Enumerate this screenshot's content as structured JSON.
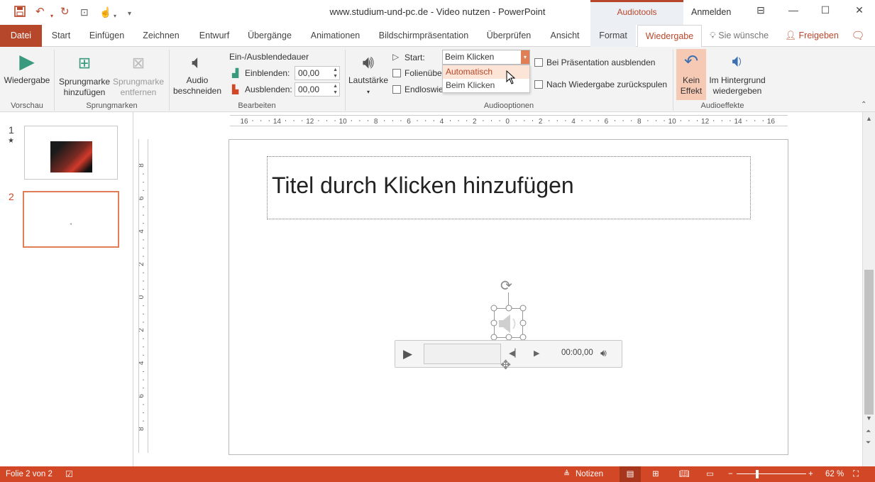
{
  "titlebar": {
    "title": "www.studium-und-pc.de - Video nutzen  -  PowerPoint",
    "context_group": "Audiotools",
    "signin": "Anmelden"
  },
  "tabs": {
    "file": "Datei",
    "items": [
      "Start",
      "Einfügen",
      "Zeichnen",
      "Entwurf",
      "Übergänge",
      "Animationen",
      "Bildschirmpräsentation",
      "Überprüfen",
      "Ansicht",
      "Format",
      "Wiedergabe"
    ],
    "tell_me": "Sie wünsche",
    "share": "Freigeben"
  },
  "ribbon": {
    "preview": {
      "play": "Wiedergabe",
      "group": "Vorschau"
    },
    "bookmarks": {
      "add_l1": "Sprungmarke",
      "add_l2": "hinzufügen",
      "remove_l1": "Sprungmarke",
      "remove_l2": "entfernen",
      "group": "Sprungmarken"
    },
    "editing": {
      "trim_l1": "Audio",
      "trim_l2": "beschneiden",
      "fade_title": "Ein-/Ausblendedauer",
      "fade_in_label": "Einblenden:",
      "fade_in_value": "00,00",
      "fade_out_label": "Ausblenden:",
      "fade_out_value": "00,00",
      "group": "Bearbeiten"
    },
    "audio_options": {
      "volume": "Lautstärke",
      "start_label": "Start:",
      "start_value": "Beim Klicken",
      "start_options": [
        "Automatisch",
        "Beim Klicken"
      ],
      "across_slides": "Folienübe",
      "loop": "Endloswie",
      "hide": "Bei Präsentation ausblenden",
      "rewind": "Nach Wiedergabe zurückspulen",
      "group": "Audiooptionen"
    },
    "audio_styles": {
      "none_l1": "Kein",
      "none_l2": "Effekt",
      "bg_l1": "Im Hintergrund",
      "bg_l2": "wiedergeben",
      "group": "Audioeffekte"
    }
  },
  "thumbnails": {
    "n1": "1",
    "star": "★",
    "n2": "2"
  },
  "slide": {
    "title_placeholder": "Titel durch Klicken hinzufügen",
    "player_time": "00:00,00"
  },
  "ruler": {
    "h_ticks": [
      "16",
      "14",
      "12",
      "10",
      "8",
      "6",
      "4",
      "2",
      "0",
      "2",
      "4",
      "6",
      "8",
      "10",
      "12",
      "14",
      "16"
    ],
    "v_ticks": [
      "8",
      "6",
      "4",
      "2",
      "0",
      "2",
      "4",
      "6",
      "8"
    ]
  },
  "status": {
    "slide_info": "Folie 2 von 2",
    "notes": "Notizen",
    "zoom": "62 %"
  },
  "colors": {
    "accent": "#b7472a",
    "status_bar": "#d24726",
    "highlight": "#fce4d6"
  }
}
